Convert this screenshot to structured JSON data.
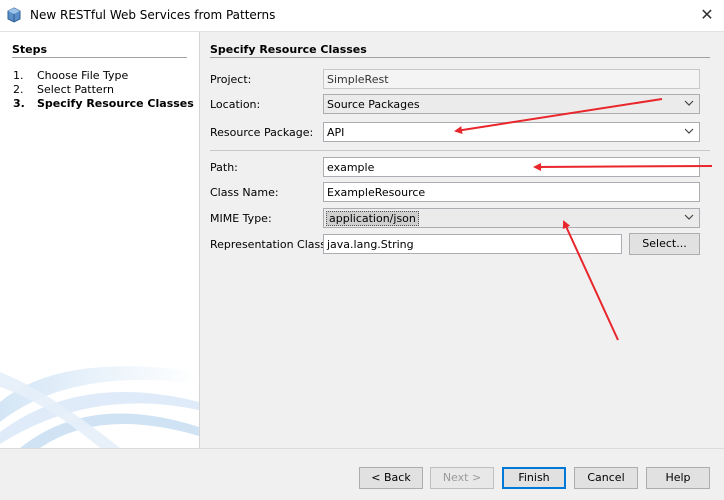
{
  "window": {
    "title": "New RESTful Web Services from Patterns",
    "close_glyph": "✕"
  },
  "steps": {
    "heading": "Steps",
    "items": [
      {
        "number": "1.",
        "label": "Choose File Type",
        "active": false
      },
      {
        "number": "2.",
        "label": "Select Pattern",
        "active": false
      },
      {
        "number": "3.",
        "label": "Specify Resource Classes",
        "active": true
      }
    ]
  },
  "main": {
    "heading": "Specify Resource Classes",
    "project": {
      "label": "Project:",
      "value": "SimpleRest"
    },
    "location": {
      "label": "Location:",
      "value": "Source Packages"
    },
    "resource_package": {
      "label": "Resource Package:",
      "value": "API"
    },
    "path": {
      "label": "Path:",
      "value": "example"
    },
    "class_name": {
      "label": "Class Name:",
      "value": "ExampleResource"
    },
    "mime_type": {
      "label": "MIME Type:",
      "value": "application/json"
    },
    "representation_class": {
      "label": "Representation Class:",
      "value": "java.lang.String",
      "select_button": "Select..."
    }
  },
  "footer": {
    "back": "< Back",
    "next": "Next >",
    "finish": "Finish",
    "cancel": "Cancel",
    "help": "Help"
  },
  "annotations": {
    "arrow_color": "#e8262b",
    "arrow_count": 3
  },
  "icons": [
    "app-icon",
    "close-icon",
    "chevron-down-icon"
  ]
}
